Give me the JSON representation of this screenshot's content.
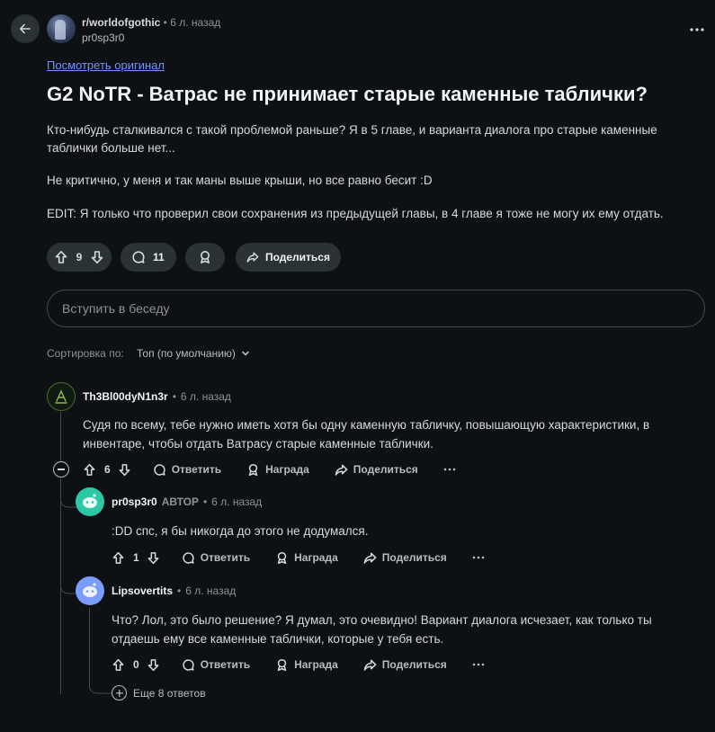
{
  "post": {
    "subreddit": "r/worldofgothic",
    "separator": "•",
    "time": "6 л. назад",
    "author": "pr0sp3r0",
    "view_original": "Посмотреть оригинал",
    "title": "G2 NoTR - Ватрас не принимает старые каменные таблички?",
    "body": [
      "Кто-нибудь сталкивался с такой проблемой раньше? Я в 5 главе, и варианта диалога про старые каменные таблички больше нет...",
      "Не критично, у меня и так маны выше крыши, но все равно бесит :D",
      "EDIT: Я только что проверил свои сохранения из предыдущей главы, в 4 главе я тоже не могу их ему отдать."
    ],
    "votes": "9",
    "comments": "11",
    "share_label": "Поделиться"
  },
  "composer": {
    "placeholder": "Вступить в беседу"
  },
  "sort": {
    "label": "Сортировка по:",
    "value": "Топ (по умолчанию)"
  },
  "comments": [
    {
      "author": "Th3Bl00dyN1n3r",
      "op_badge": "",
      "time": "6 л. назад",
      "text": "Судя по всему, тебе нужно иметь хотя бы одну каменную табличку, повышающую характеристики, в инвентаре, чтобы отдать Ватрасу старые каменные таблички.",
      "votes": "6"
    },
    {
      "author": "pr0sp3r0",
      "op_badge": "АВТОР",
      "time": "6 л. назад",
      "text": ":DD спс, я бы никогда до этого не додумался.",
      "votes": "1"
    },
    {
      "author": "Lipsovertits",
      "op_badge": "",
      "time": "6 л. назад",
      "text": "Что? Лол, это было решение? Я думал, это очевидно! Вариант диалога исчезает, как только ты отдаешь ему все каменные таблички, которые у тебя есть.",
      "votes": "0"
    }
  ],
  "actions": {
    "reply": "Ответить",
    "award": "Награда",
    "share": "Поделиться"
  },
  "more_replies": "Еще 8 ответов",
  "colors": {
    "background": "#0e1113",
    "pill": "#2a3236",
    "link": "#7193ff",
    "op_badge": "#6a9cff",
    "avatar_green": "#2ec7a5",
    "avatar_blue": "#7a9cff"
  },
  "icons": [
    "arrow-left-icon",
    "more-horizontal-icon",
    "upvote-icon",
    "downvote-icon",
    "comment-icon",
    "award-icon",
    "share-icon",
    "chevron-down-icon",
    "collapse-icon",
    "plus-circle-icon"
  ]
}
